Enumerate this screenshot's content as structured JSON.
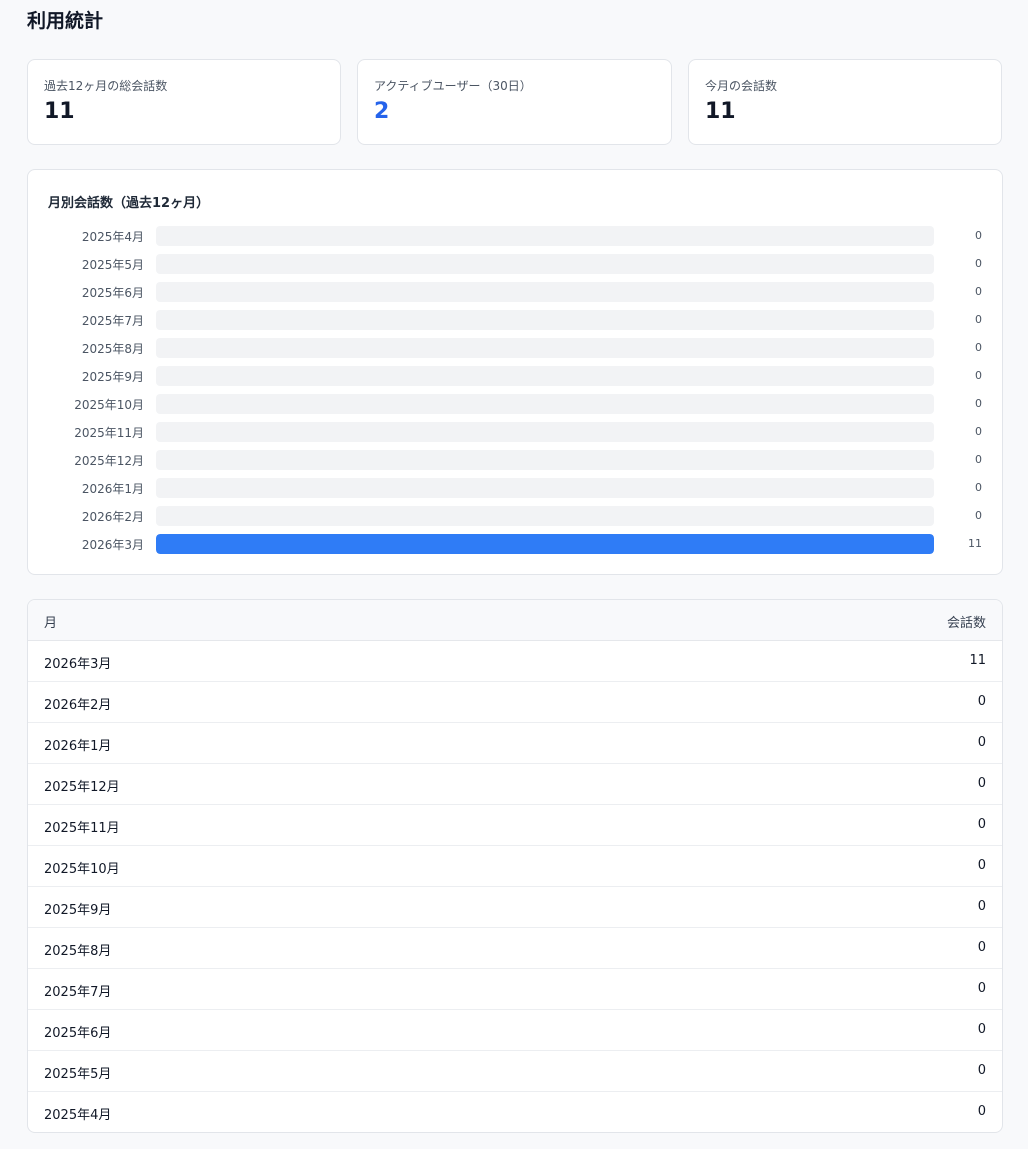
{
  "page": {
    "title": "利用統計"
  },
  "stats": [
    {
      "label": "過去12ヶ月の総会話数",
      "value": "11",
      "accent": false
    },
    {
      "label": "アクティブユーザー（30日）",
      "value": "2",
      "accent": true
    },
    {
      "label": "今月の会話数",
      "value": "11",
      "accent": false
    }
  ],
  "colors": {
    "accent": "#2563eb",
    "bar": "#2f7cf6",
    "track": "#f2f3f5"
  },
  "chart_data": {
    "type": "bar",
    "orientation": "horizontal",
    "title": "月別会話数（過去12ヶ月）",
    "categories": [
      "2025年4月",
      "2025年5月",
      "2025年6月",
      "2025年7月",
      "2025年8月",
      "2025年9月",
      "2025年10月",
      "2025年11月",
      "2025年12月",
      "2026年1月",
      "2026年2月",
      "2026年3月"
    ],
    "values": [
      0,
      0,
      0,
      0,
      0,
      0,
      0,
      0,
      0,
      0,
      0,
      11
    ],
    "value_labels": [
      "0",
      "0",
      "0",
      "0",
      "0",
      "0",
      "0",
      "0",
      "0",
      "0",
      "0",
      "11"
    ],
    "xlim": [
      0,
      11
    ],
    "grid": false
  },
  "table": {
    "headers": {
      "month": "月",
      "count": "会話数"
    },
    "rows": [
      {
        "month": "2026年3月",
        "count": "11"
      },
      {
        "month": "2026年2月",
        "count": "0"
      },
      {
        "month": "2026年1月",
        "count": "0"
      },
      {
        "month": "2025年12月",
        "count": "0"
      },
      {
        "month": "2025年11月",
        "count": "0"
      },
      {
        "month": "2025年10月",
        "count": "0"
      },
      {
        "month": "2025年9月",
        "count": "0"
      },
      {
        "month": "2025年8月",
        "count": "0"
      },
      {
        "month": "2025年7月",
        "count": "0"
      },
      {
        "month": "2025年6月",
        "count": "0"
      },
      {
        "month": "2025年5月",
        "count": "0"
      },
      {
        "month": "2025年4月",
        "count": "0"
      }
    ]
  }
}
